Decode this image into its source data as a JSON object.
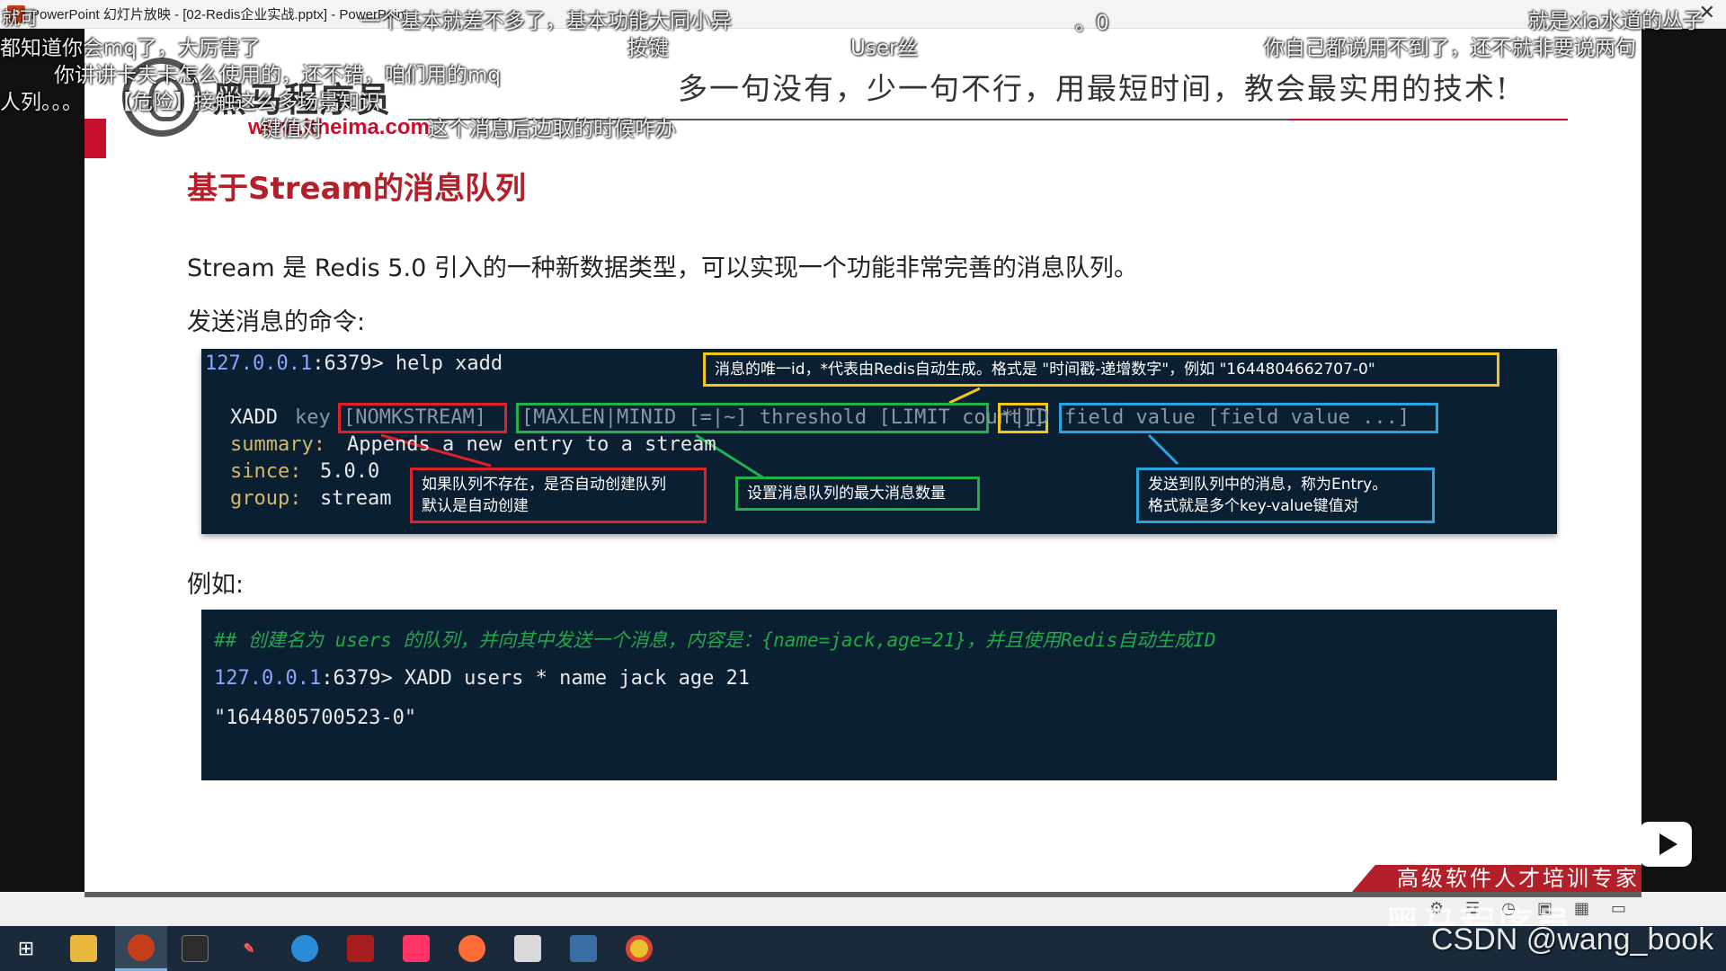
{
  "window": {
    "title": "PowerPoint 幻灯片放映 - [02-Redis企业实战.pptx] - PowerPoint",
    "close_glyph": "✕"
  },
  "slide": {
    "logo_name": "黑马程序员",
    "logo_url": "www.itheima.com",
    "slogan": "多一句没有，少一句不行，用最短时间，教会最实用的技术!",
    "title": "基于Stream的消息队列",
    "intro": "Stream 是 Redis 5.0 引入的一种新数据类型，可以实现一个功能非常完善的消息队列。",
    "send_label": "发送消息的命令:",
    "example_label": "例如:",
    "banner": "高级软件人才培训专家"
  },
  "terminal1": {
    "prompt_ip": "127.0.0.1",
    "prompt_rest": ":6379> help xadd",
    "xadd": "XADD",
    "key": "key",
    "nomkstream": "[NOMKSTREAM]",
    "maxlen": "[MAXLEN|MINID [=|~] threshold [LIMIT count]]",
    "id": "*|ID",
    "field_value": "field value [field value ...]",
    "summary_label": "summary:",
    "summary_value": "Appends a new entry to a stream",
    "since_label": "since:",
    "since_value": "5.0.0",
    "group_label": "group:",
    "group_value": "stream",
    "note_id": "消息的唯一id，*代表由Redis自动生成。格式是 \"时间戳-递增数字\"，例如 \"1644804662707-0\"",
    "note_nomk_1": "如果队列不存在，是否自动创建队列",
    "note_nomk_2": "默认是自动创建",
    "note_maxlen": "设置消息队列的最大消息数量",
    "note_field_1": "发送到队列中的消息，称为Entry。",
    "note_field_2": "格式就是多个key-value键值对"
  },
  "terminal2": {
    "comment": "## 创建名为 users 的队列，并向其中发送一个消息，内容是：{name=jack,age=21}，并且使用Redis自动生成ID",
    "prompt_ip": "127.0.0.1",
    "command": ":6379> XADD users * name jack age 21",
    "result": "\"1644805700523-0\""
  },
  "danmaku": [
    "就可",
    "一个基本就差不多了，基本功能大同小异",
    "。0",
    "就是xia水道的丛子",
    "都知道你会mq了，大厉害了",
    "按键",
    "User丝",
    "你自己都说用不到了，还不就非要说两句",
    "你讲讲卡夫卡怎么使用的，还不错，咱们用的mq",
    "人列。。。",
    "【危险】接触这么多场景知识",
    "键值对",
    "这个消息后边取的时候咋办"
  ],
  "watermark": "CSDN @wang_book",
  "watermark_cn": "黑马程序员",
  "taskbar": {
    "start_glyph": "⊞",
    "items": [
      "file-explorer",
      "powerpoint",
      "terminal",
      "pen",
      "browser-edge",
      "redis",
      "intellij",
      "postman",
      "typora",
      "screenshot",
      "chrome"
    ]
  }
}
